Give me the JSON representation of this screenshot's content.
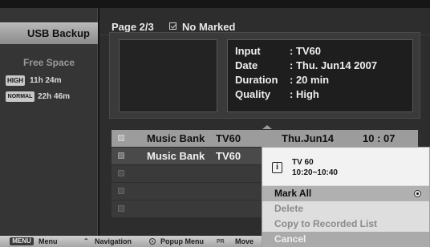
{
  "sidebar": {
    "tab_label": "USB Backup",
    "free_space_label": "Free Space",
    "quality": [
      {
        "badge": "HIGH",
        "time": "11h 24m"
      },
      {
        "badge": "NORMAL",
        "time": "22h 46m"
      }
    ]
  },
  "header": {
    "page": "Page 2/3",
    "mark_status": "No Marked"
  },
  "info": {
    "lines": [
      {
        "key": "Input",
        "value": ": TV60"
      },
      {
        "key": "Date",
        "value": ": Thu. Jun14 2007"
      },
      {
        "key": "Duration",
        "value": ": 20 min"
      },
      {
        "key": "Quality",
        "value": ": High"
      }
    ]
  },
  "recordings": [
    {
      "title": "Music Bank",
      "channel": "TV60",
      "date": "Thu.Jun14",
      "time": "10 : 07",
      "selected": true
    },
    {
      "title": "Music Bank",
      "channel": "TV60",
      "date": "",
      "time": "",
      "selected": false
    },
    {
      "title": "",
      "channel": "",
      "date": "",
      "time": "",
      "selected": false
    },
    {
      "title": "",
      "channel": "",
      "date": "",
      "time": "",
      "selected": false
    },
    {
      "title": "",
      "channel": "",
      "date": "",
      "time": "",
      "selected": false
    }
  ],
  "popup": {
    "channel": "TV 60",
    "time_range": "10:20~10:40",
    "items": [
      {
        "label": "Mark All",
        "state": "selected"
      },
      {
        "label": "Delete",
        "state": "disabled"
      },
      {
        "label": "Copy to Recorded List",
        "state": "disabled"
      },
      {
        "label": "Cancel",
        "state": "normal"
      }
    ]
  },
  "help_bar": {
    "menu_key": "MENU",
    "menu": "Menu",
    "navigation": "Navigation",
    "popup_menu": "Popup Menu",
    "move_key": "PR",
    "move": "Move"
  },
  "colors": {
    "selected_row": "#9c9c9c",
    "popup_highlight": "#b0b0b0",
    "tab": "#a2a2a2"
  }
}
